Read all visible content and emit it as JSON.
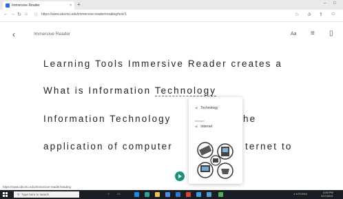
{
  "browser": {
    "tab_title": "Immersive Reader",
    "tab_close": "×",
    "new_tab": "+",
    "minimize": "–",
    "maximize": "□",
    "url": "https://www.abcmu.edu/immersive-reader/reading/text/1",
    "back": "←",
    "forward": "→",
    "refresh": "↻",
    "home": "⌂",
    "lock": "ⓘ",
    "favorite": "☆",
    "favorites_bar": "✰",
    "share": "⇪",
    "profile": "☺"
  },
  "reader": {
    "back": "‹",
    "title": "Immersive Reader",
    "text_pref_icon": "Aa",
    "grammar_icon": "≡",
    "reading_pref_icon": "▯",
    "lines": [
      "Learning Tools Immersive Reader creates a",
      "What is Information ",
      "Technology",
      "Information Technology",
      "he",
      "application of computer",
      "ternet to"
    ]
  },
  "dictionary_popup": {
    "word": "Technology",
    "section_label": "Internet",
    "item": "Internet",
    "speaker_icon": "🔊"
  },
  "status_bar": "https://www.abcmu.edu/immersive-reader/reading",
  "taskbar": {
    "search_placeholder": "Type here to search",
    "task_view": "▭",
    "search_icon": "⚲",
    "tray": "∧ ♦ ⊡ ENG",
    "time": "4:05 PM",
    "date": "2/17/2021"
  },
  "colors": {
    "accent": "#1f8f7a",
    "taskbar": "#1a1d24"
  }
}
